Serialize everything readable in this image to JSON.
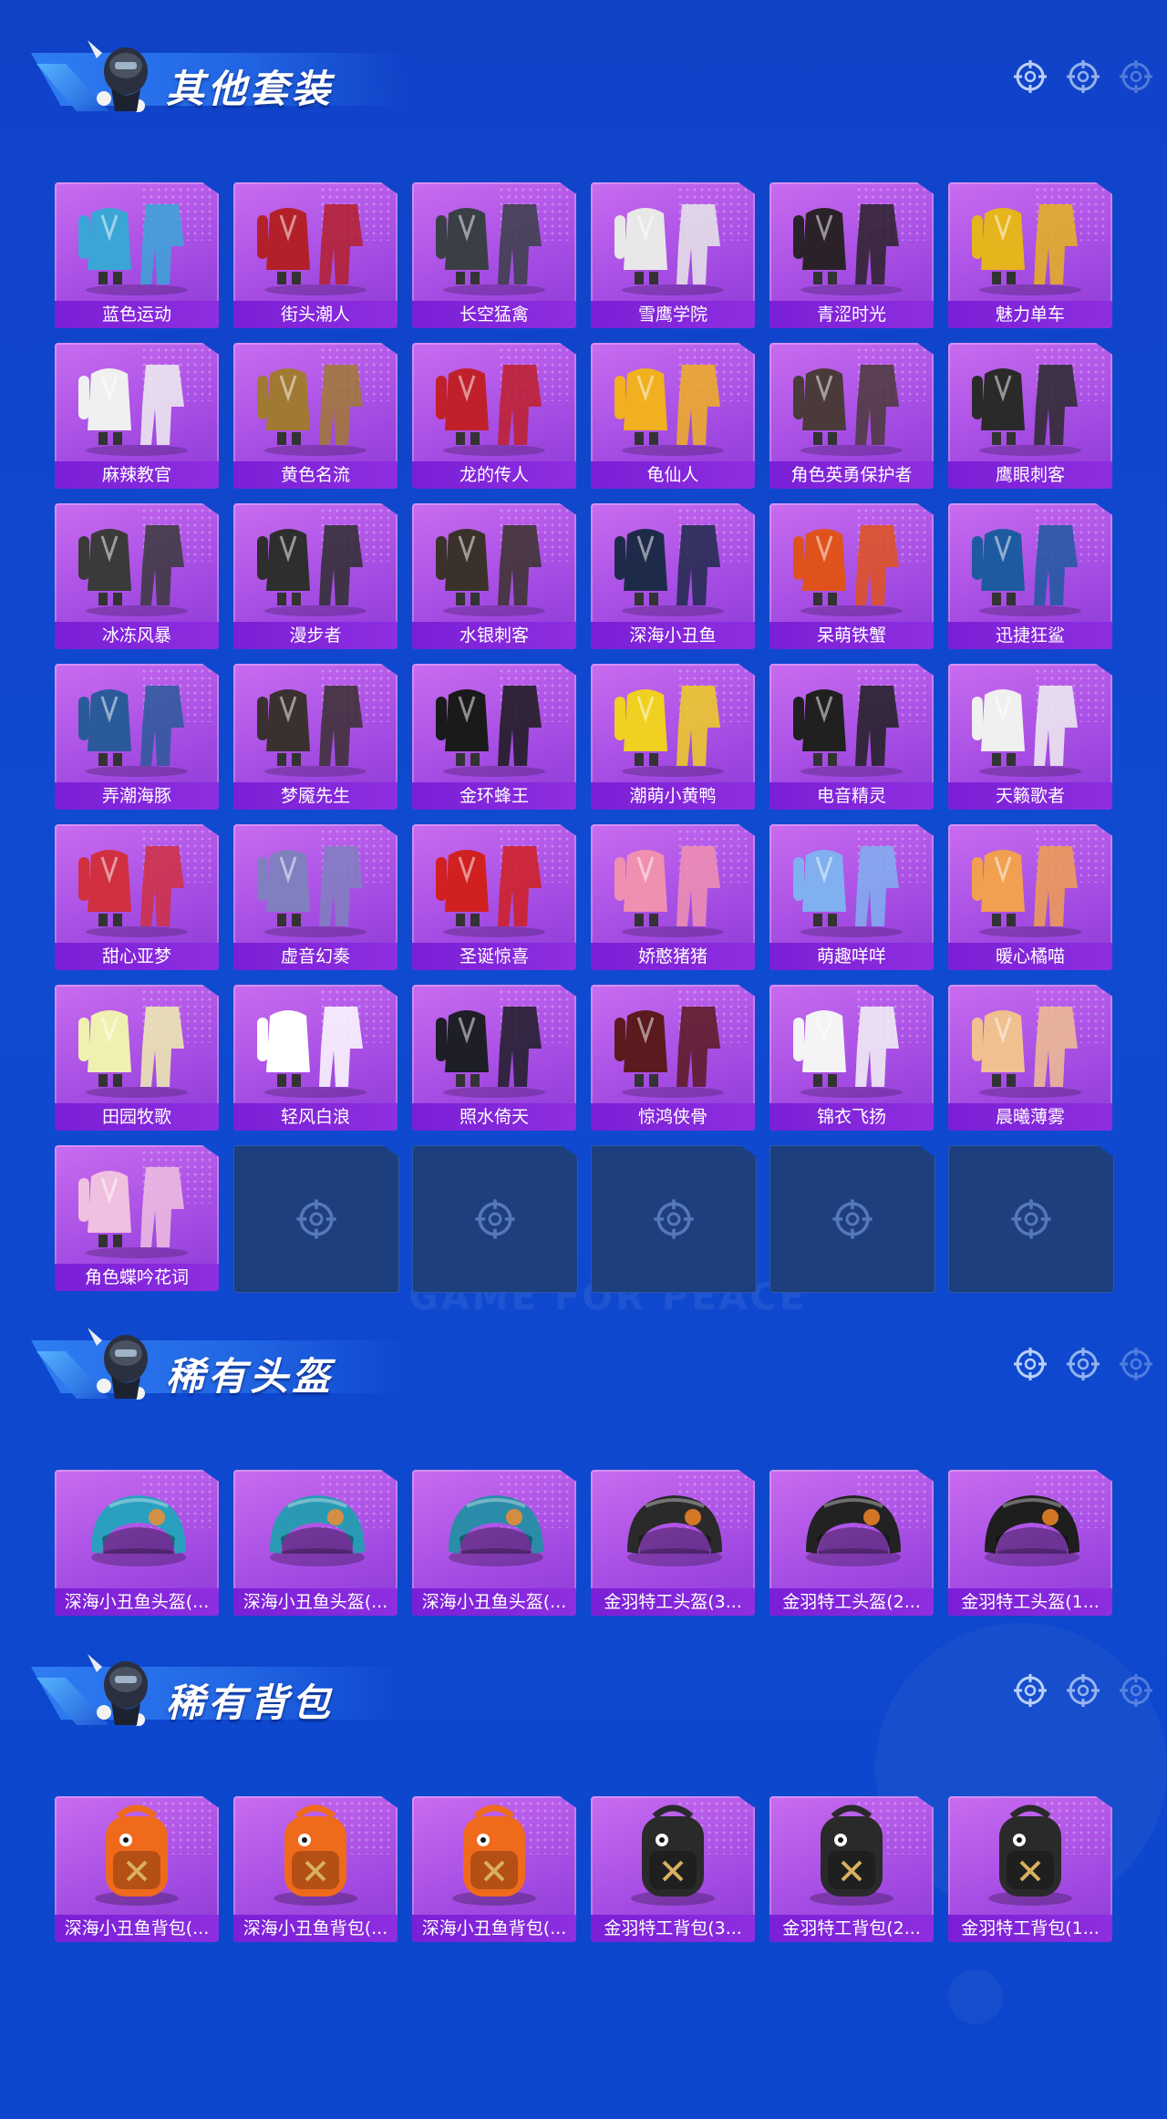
{
  "colors": {
    "background": "#1042c8",
    "card": "#b45ae8",
    "card_label": "#7a1fd6",
    "empty_slot": "#1e3f7e",
    "title": "#ffffff"
  },
  "watermark": "GAME FOR PEACE",
  "sections": [
    {
      "title": "其他套装",
      "icon": "mascot-icon",
      "items": [
        {
          "label": "蓝色运动",
          "icon": "outfit-icon",
          "accent": "#3aa6d6"
        },
        {
          "label": "街头潮人",
          "icon": "outfit-icon",
          "accent": "#b4202a"
        },
        {
          "label": "长空猛禽",
          "icon": "outfit-icon",
          "accent": "#3a3f46"
        },
        {
          "label": "雪鹰学院",
          "icon": "outfit-icon",
          "accent": "#e8e8e8"
        },
        {
          "label": "青涩时光",
          "icon": "outfit-icon",
          "accent": "#2a2228"
        },
        {
          "label": "魅力单车",
          "icon": "outfit-icon",
          "accent": "#e6b41c"
        },
        {
          "label": "麻辣教官",
          "icon": "outfit-icon",
          "accent": "#f0f0f0"
        },
        {
          "label": "黄色名流",
          "icon": "outfit-icon",
          "accent": "#a07a32"
        },
        {
          "label": "龙的传人",
          "icon": "outfit-icon",
          "accent": "#c0202a"
        },
        {
          "label": "龟仙人",
          "icon": "outfit-icon",
          "accent": "#f0b020"
        },
        {
          "label": "角色英勇保护者",
          "icon": "outfit-icon",
          "accent": "#4a3a3a"
        },
        {
          "label": "鹰眼刺客",
          "icon": "outfit-icon",
          "accent": "#2a2a2a"
        },
        {
          "label": "冰冻风暴",
          "icon": "outfit-icon",
          "accent": "#3a3a3a"
        },
        {
          "label": "漫步者",
          "icon": "outfit-icon",
          "accent": "#2e2e2e"
        },
        {
          "label": "水银刺客",
          "icon": "outfit-icon",
          "accent": "#3a322a"
        },
        {
          "label": "深海小丑鱼",
          "icon": "outfit-icon",
          "accent": "#1e2a4a"
        },
        {
          "label": "呆萌铁蟹",
          "icon": "outfit-icon",
          "accent": "#e0521c"
        },
        {
          "label": "迅捷狂鲨",
          "icon": "outfit-icon",
          "accent": "#1e5aa0"
        },
        {
          "label": "弄潮海豚",
          "icon": "outfit-icon",
          "accent": "#2a5a9a"
        },
        {
          "label": "梦魇先生",
          "icon": "outfit-icon",
          "accent": "#3a3030"
        },
        {
          "label": "金环蜂王",
          "icon": "outfit-icon",
          "accent": "#1a1a1a"
        },
        {
          "label": "潮萌小黄鸭",
          "icon": "outfit-icon",
          "accent": "#f0d020"
        },
        {
          "label": "电音精灵",
          "icon": "outfit-icon",
          "accent": "#202020"
        },
        {
          "label": "天籁歌者",
          "icon": "outfit-icon",
          "accent": "#f0f0f0"
        },
        {
          "label": "甜心亚梦",
          "icon": "outfit-icon",
          "accent": "#d03040"
        },
        {
          "label": "虚音幻奏",
          "icon": "outfit-icon",
          "accent": "#8080c0"
        },
        {
          "label": "圣诞惊喜",
          "icon": "outfit-icon",
          "accent": "#d02020"
        },
        {
          "label": "娇憨猪猪",
          "icon": "outfit-icon",
          "accent": "#f090b0"
        },
        {
          "label": "萌趣咩咩",
          "icon": "outfit-icon",
          "accent": "#80b0f0"
        },
        {
          "label": "暖心橘喵",
          "icon": "outfit-icon",
          "accent": "#f0a050"
        },
        {
          "label": "田园牧歌",
          "icon": "outfit-icon",
          "accent": "#f0f0b0"
        },
        {
          "label": "轻风白浪",
          "icon": "outfit-icon",
          "accent": "#ffffff"
        },
        {
          "label": "照水倚天",
          "icon": "outfit-icon",
          "accent": "#1e1e26"
        },
        {
          "label": "惊鸿侠骨",
          "icon": "outfit-icon",
          "accent": "#5a1a1e"
        },
        {
          "label": "锦衣飞扬",
          "icon": "outfit-icon",
          "accent": "#f4f4f4"
        },
        {
          "label": "晨曦薄雾",
          "icon": "outfit-icon",
          "accent": "#f0c090"
        },
        {
          "label": "角色蝶吟花词",
          "icon": "outfit-icon",
          "accent": "#f0c0e0"
        }
      ],
      "empty_slots": 5
    },
    {
      "title": "稀有头盔",
      "icon": "mascot-icon",
      "items": [
        {
          "label": "深海小丑鱼头盔(...",
          "icon": "helmet-icon",
          "accent": "#2aa0c0"
        },
        {
          "label": "深海小丑鱼头盔(...",
          "icon": "helmet-icon",
          "accent": "#2a9ab4"
        },
        {
          "label": "深海小丑鱼头盔(...",
          "icon": "helmet-icon",
          "accent": "#2a8ca8"
        },
        {
          "label": "金羽特工头盔(3...",
          "icon": "helmet-icon",
          "accent": "#2a2a2a"
        },
        {
          "label": "金羽特工头盔(2...",
          "icon": "helmet-icon",
          "accent": "#222222"
        },
        {
          "label": "金羽特工头盔(1...",
          "icon": "helmet-icon",
          "accent": "#1e1e1e"
        }
      ],
      "empty_slots": 0
    },
    {
      "title": "稀有背包",
      "icon": "mascot-icon",
      "items": [
        {
          "label": "深海小丑鱼背包(...",
          "icon": "backpack-icon",
          "accent": "#f06a1c"
        },
        {
          "label": "深海小丑鱼背包(...",
          "icon": "backpack-icon",
          "accent": "#f06a1c"
        },
        {
          "label": "深海小丑鱼背包(...",
          "icon": "backpack-icon",
          "accent": "#f06a1c"
        },
        {
          "label": "金羽特工背包(3...",
          "icon": "backpack-icon",
          "accent": "#2a2a2a"
        },
        {
          "label": "金羽特工背包(2...",
          "icon": "backpack-icon",
          "accent": "#2a2a2a"
        },
        {
          "label": "金羽特工背包(1...",
          "icon": "backpack-icon",
          "accent": "#2a2a2a"
        }
      ],
      "empty_slots": 0
    }
  ]
}
